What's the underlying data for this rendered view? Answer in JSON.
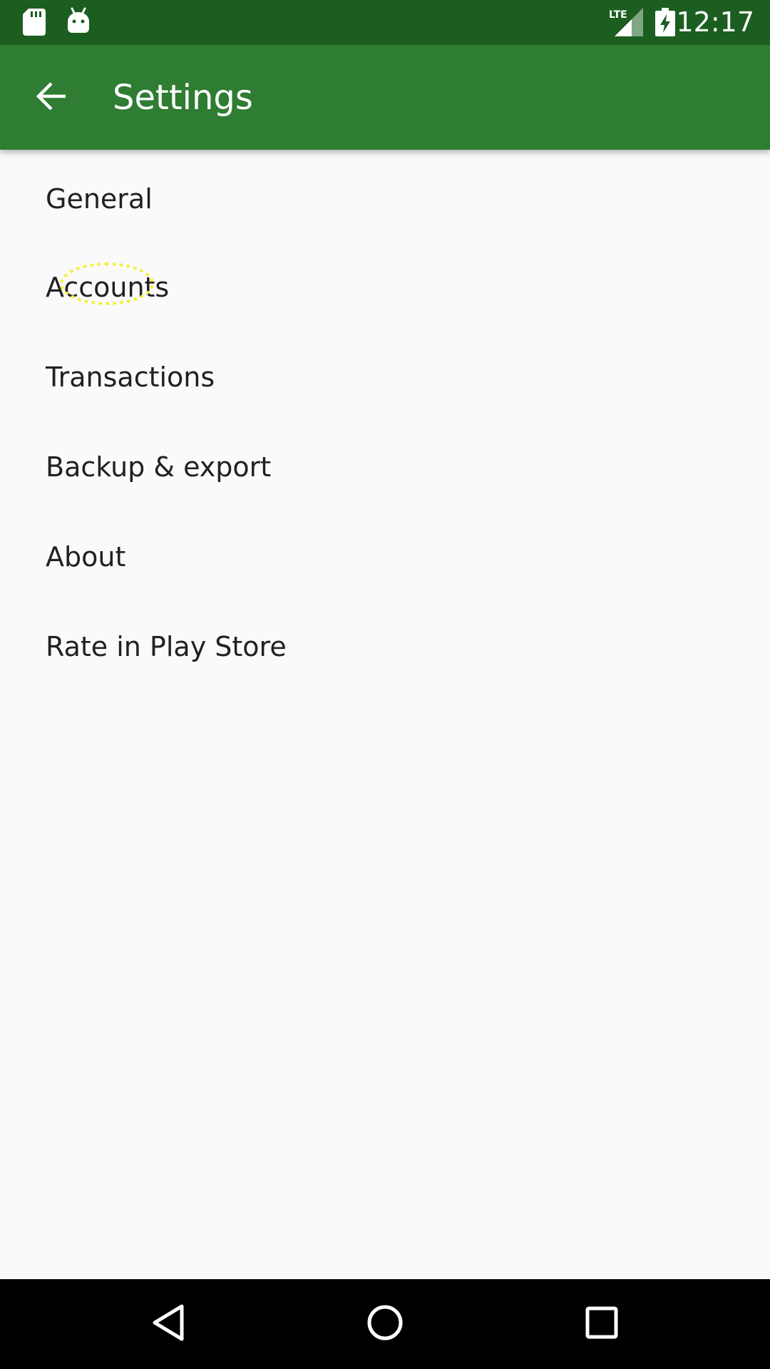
{
  "status_bar": {
    "time": "12:17",
    "network": "LTE",
    "icons": [
      "sd-card-icon",
      "android-debug-icon",
      "lte-signal-icon",
      "battery-charging-icon"
    ]
  },
  "app_bar": {
    "title": "Settings",
    "back_icon": "arrow-back-icon"
  },
  "settings": {
    "items": [
      {
        "label": "General"
      },
      {
        "label": "Accounts"
      },
      {
        "label": "Transactions"
      },
      {
        "label": "Backup & export"
      },
      {
        "label": "About"
      },
      {
        "label": "Rate in Play Store"
      }
    ]
  },
  "nav_bar": {
    "icons": [
      "nav-back-icon",
      "nav-home-icon",
      "nav-recents-icon"
    ]
  },
  "colors": {
    "status_bar": "#1b5e20",
    "app_bar": "#2e7d32",
    "background": "#fafafa",
    "text": "#212121",
    "touch_marker": "#f2f23a"
  }
}
